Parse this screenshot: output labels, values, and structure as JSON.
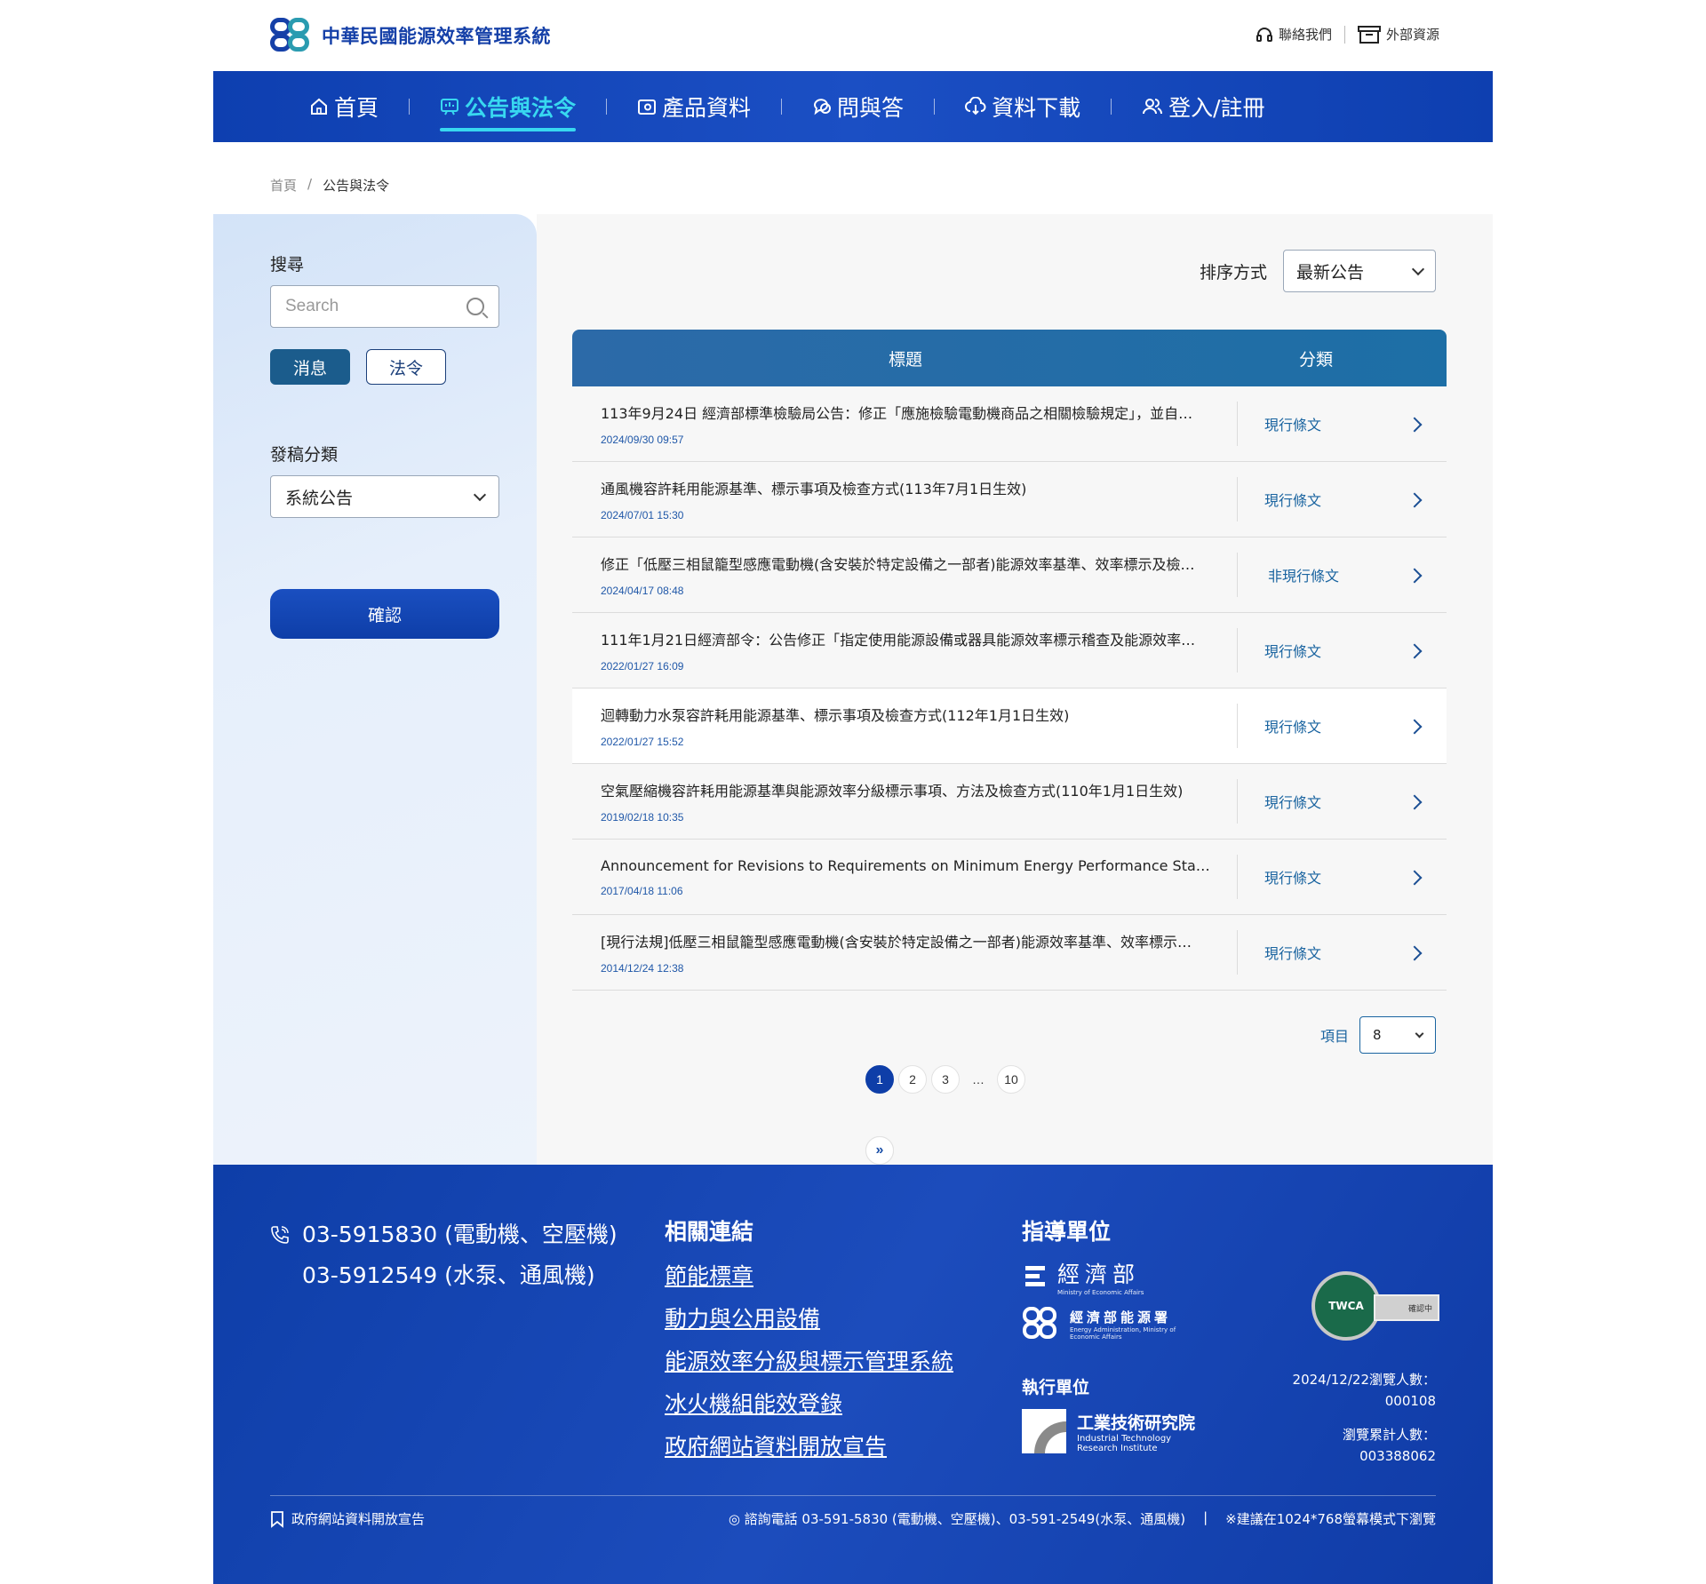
{
  "header": {
    "site_title": "中華民國能源效率管理系統",
    "contact_label": "聯絡我們",
    "resources_label": "外部資源"
  },
  "nav": {
    "items": [
      {
        "label": "首頁",
        "icon": "home-icon"
      },
      {
        "label": "公告與法令",
        "icon": "announcement-icon",
        "active": true
      },
      {
        "label": "產品資料",
        "icon": "product-icon"
      },
      {
        "label": "問與答",
        "icon": "chat-icon"
      },
      {
        "label": "資料下載",
        "icon": "cloud-download-icon"
      },
      {
        "label": "登入/註冊",
        "icon": "users-icon"
      }
    ]
  },
  "breadcrumb": {
    "home": "首頁",
    "sep": "/",
    "current": "公告與法令"
  },
  "sidebar": {
    "search_label": "搜尋",
    "search_placeholder": "Search",
    "tab_news": "消息",
    "tab_law": "法令",
    "category_label": "發稿分類",
    "category_value": "系統公告",
    "confirm_label": "確認"
  },
  "main": {
    "sort_label": "排序方式",
    "sort_value": "最新公告",
    "col_title": "標題",
    "col_category": "分類",
    "rows": [
      {
        "title": "113年9月24日 經濟部標準檢驗局公告：修正「應施檢驗電動機商品之相關檢驗規定」，並自…",
        "date": "2024/09/30 09:57",
        "category": "現行條文"
      },
      {
        "title": "通風機容許耗用能源基準、標示事項及檢查方式(113年7月1日生效)",
        "date": "2024/07/01 15:30",
        "category": "現行條文"
      },
      {
        "title": "修正「低壓三相鼠籠型感應電動機(含安裝於特定設備之一部者)能源效率基準、效率標示及檢…",
        "date": "2024/04/17 08:48",
        "category": "非現行條文"
      },
      {
        "title": "111年1月21日經濟部令：公告修正「指定使用能源設備或器具能源效率標示稽查及能源效率…",
        "date": "2022/01/27 16:09",
        "category": "現行條文"
      },
      {
        "title": "迴轉動力水泵容許耗用能源基準、標示事項及檢查方式(112年1月1日生效)",
        "date": "2022/01/27 15:52",
        "category": "現行條文"
      },
      {
        "title": "空氣壓縮機容許耗用能源基準與能源效率分級標示事項、方法及檢查方式(110年1月1日生效)",
        "date": "2019/02/18 10:35",
        "category": "現行條文"
      },
      {
        "title": "Announcement for Revisions to Requirements on Minimum Energy Performance Standa…",
        "date": "2017/04/18 11:06",
        "category": "現行條文"
      },
      {
        "title": "[現行法規]低壓三相鼠籠型感應電動機(含安裝於特定設備之一部者)能源效率基準、效率標示…",
        "date": "2014/12/24 12:38",
        "category": "現行條文"
      }
    ],
    "per_page_label": "項目",
    "per_page_value": "8",
    "pager": {
      "first": "«",
      "prev": "‹",
      "p1": "1",
      "p2": "2",
      "p3": "3",
      "dots": "…",
      "p10": "10",
      "next": "›",
      "last": "»"
    }
  },
  "footer": {
    "phone_1": "03-5915830 (電動機、空壓機)",
    "phone_2": "03-5912549 (水泵、通風機)",
    "links_heading": "相關連結",
    "links": [
      "節能標章",
      "動力與公用設備",
      "能源效率分級與標示管理系統",
      "冰火機組能效登錄",
      "政府網站資料開放宣告"
    ],
    "guide_heading": "指導單位",
    "org_1": "經濟部",
    "org_1_en": "Ministry of Economic Affairs",
    "org_2": "經濟部能源署",
    "org_2_en": "Energy Administration, Ministry of Economic Affairs",
    "exec_heading": "執行單位",
    "exec_name": "工業技術研究院",
    "exec_en": "Industrial Technology Research Institute",
    "badge_text": "TWCA",
    "badge_sub": "確認中",
    "counter_today_label": "2024/12/22瀏覽人數：",
    "counter_today": "000108",
    "counter_total_label": "瀏覽累計人數：",
    "counter_total": "003388062",
    "bottom_left": "政府網站資料開放宣告",
    "bottom_phone": "◎ 諮詢電話 03-591-5830 (電動機、空壓機)、03-591-2549(水泵、通風機)",
    "bottom_sep": "|",
    "bottom_note": "※建議在1024*768螢幕模式下瀏覽"
  }
}
